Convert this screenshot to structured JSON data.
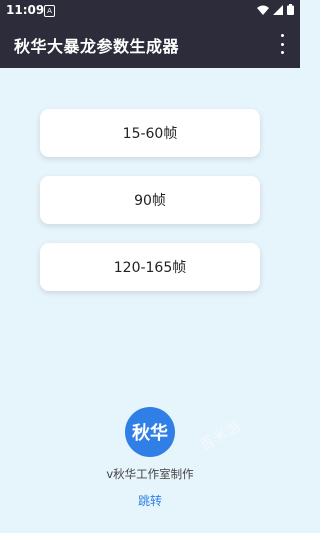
{
  "status_bar": {
    "time": "11:09",
    "notif_badge": "A"
  },
  "app_bar": {
    "title": "秋华大暴龙参数生成器",
    "overflow_icon": "more-vert-icon"
  },
  "buttons": [
    {
      "label": "15-60帧"
    },
    {
      "label": "90帧"
    },
    {
      "label": "120-165帧"
    }
  ],
  "footer": {
    "avatar_text": "秋华",
    "credit": "v秋华工作室制作",
    "jump_link": "跳转",
    "accent_color": "#2f7fe6"
  },
  "watermark": "百米游"
}
